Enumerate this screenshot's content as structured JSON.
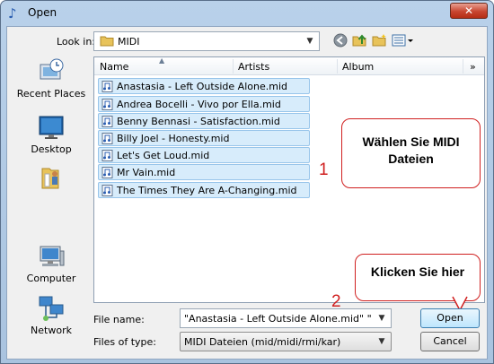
{
  "window": {
    "title": "Open",
    "close_glyph": "✕"
  },
  "toolbar": {
    "lookin_label": "Look in:",
    "lookin_value": "MIDI",
    "icons": [
      "back-icon",
      "up-folder-icon",
      "new-folder-icon",
      "views-menu-icon"
    ]
  },
  "places": [
    {
      "label": "Recent Places",
      "icon": "recent-places-icon"
    },
    {
      "label": "Desktop",
      "icon": "desktop-icon"
    },
    {
      "label": "",
      "icon": "user-folder-icon"
    },
    {
      "label": "Computer",
      "icon": "computer-icon"
    },
    {
      "label": "Network",
      "icon": "network-icon"
    }
  ],
  "columns": {
    "name": "Name",
    "artists": "Artists",
    "album": "Album",
    "more": "»"
  },
  "files": [
    "Anastasia - Left Outside Alone.mid",
    "Andrea Bocelli - Vivo por Ella.mid",
    "Benny Bennasi - Satisfaction.mid",
    "Billy Joel - Honesty.mid",
    "Let's Get Loud.mid",
    "Mr Vain.mid",
    "The Times They Are A-Changing.mid"
  ],
  "callouts": {
    "select": {
      "number": "1",
      "text_line1": "Wählen Sie MIDI",
      "text_line2": "Dateien"
    },
    "click": {
      "number": "2",
      "text": "Klicken Sie hier"
    }
  },
  "bottom": {
    "file_name_label": "File name:",
    "file_name_value": "\"Anastasia - Left Outside Alone.mid\" \"Andrea B",
    "file_type_label": "Files of type:",
    "file_type_value": "MIDI Dateien (mid/midi/rmi/kar)",
    "open_label": "Open",
    "cancel_label": "Cancel"
  },
  "colors": {
    "accent": "#3c7fb1",
    "callout_red": "#d02020",
    "selection": "#d7ecfb"
  }
}
